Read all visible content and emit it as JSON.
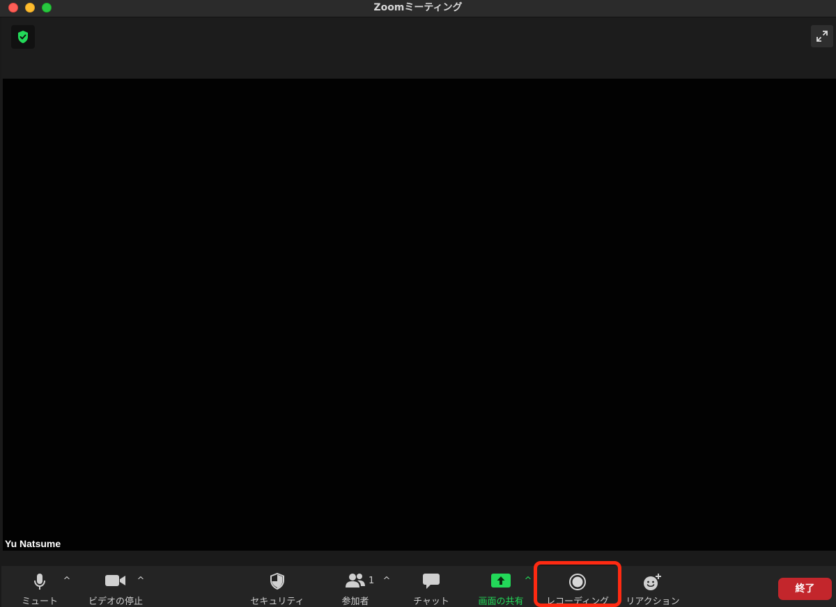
{
  "window": {
    "title": "Zoomミーティング"
  },
  "video": {
    "participant_name": "Yu Natsume"
  },
  "toolbar": {
    "mute_label": "ミュート",
    "video_label": "ビデオの停止",
    "security_label": "セキュリティ",
    "participants_label": "参加者",
    "participants_count": "1",
    "chat_label": "チャット",
    "share_label": "画面の共有",
    "record_label": "レコーディング",
    "reactions_label": "リアクション",
    "caret_glyph": "^",
    "end_label": "終了"
  },
  "colors": {
    "share_accent": "#23d959",
    "end_button": "#c3262c",
    "highlight": "#ff2a12",
    "shield": "#23d959"
  },
  "icons": {
    "encryption": "shield-check-icon",
    "fullscreen": "expand-icon",
    "mute": "microphone-icon",
    "video": "video-camera-icon",
    "security": "security-shield-icon",
    "participants": "people-icon",
    "chat": "chat-bubble-icon",
    "share": "share-screen-arrow-icon",
    "record": "record-icon",
    "reactions": "smiley-plus-icon"
  }
}
